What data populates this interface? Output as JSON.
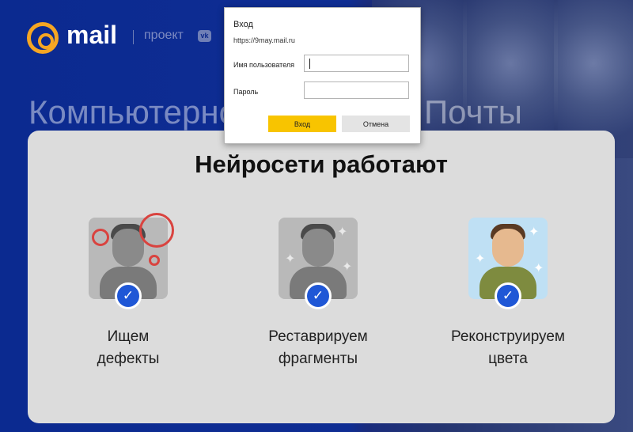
{
  "brand": {
    "logo": "mail",
    "project": "проект",
    "vk_badge": "vk"
  },
  "headline": "Компьютерное зрение от Почты",
  "card": {
    "title": "Нейросети работают",
    "steps": [
      {
        "line1": "Ищем",
        "line2": "дефекты",
        "style": "grayscale-with-defect-rings"
      },
      {
        "line1": "Реставрируем",
        "line2": "фрагменты",
        "style": "grayscale-restored"
      },
      {
        "line1": "Реконструируем",
        "line2": "цвета",
        "style": "colorized"
      }
    ],
    "check_icon": "check-icon"
  },
  "login_dialog": {
    "title": "Вход",
    "url": "https://9may.mail.ru",
    "username_label": "Имя пользователя",
    "username_value": "",
    "password_label": "Пароль",
    "password_value": "",
    "ok_label": "Вход",
    "cancel_label": "Отмена"
  },
  "colors": {
    "background": "#0e2a8a",
    "accent": "#f8c400",
    "check": "#1f57d6",
    "defect_ring": "#d9433f"
  }
}
